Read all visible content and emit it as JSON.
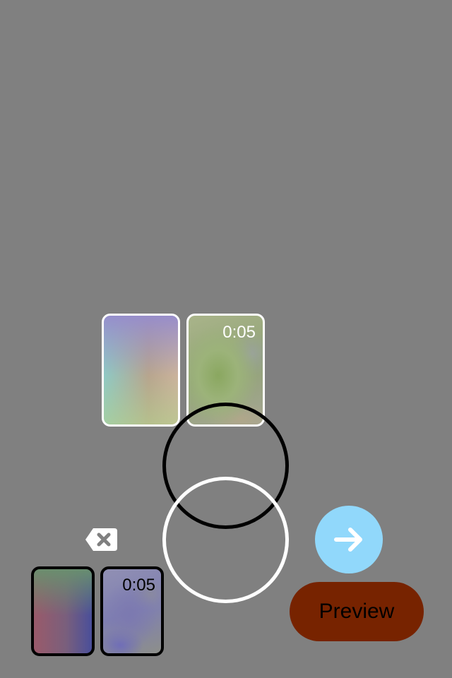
{
  "timeline": {
    "items": [
      {
        "kind": "image",
        "duration": ""
      },
      {
        "kind": "video",
        "duration": "0:05"
      }
    ]
  },
  "gallery": {
    "items": [
      {
        "kind": "image",
        "duration": ""
      },
      {
        "kind": "video",
        "duration": "0:05"
      }
    ]
  },
  "controls": {
    "delete_icon": "backspace-icon",
    "next_icon": "arrow-right-icon",
    "preview_label": "Preview"
  },
  "colors": {
    "background": "#808080",
    "next_button": "#91d8fb",
    "preview_button": "#772300"
  }
}
